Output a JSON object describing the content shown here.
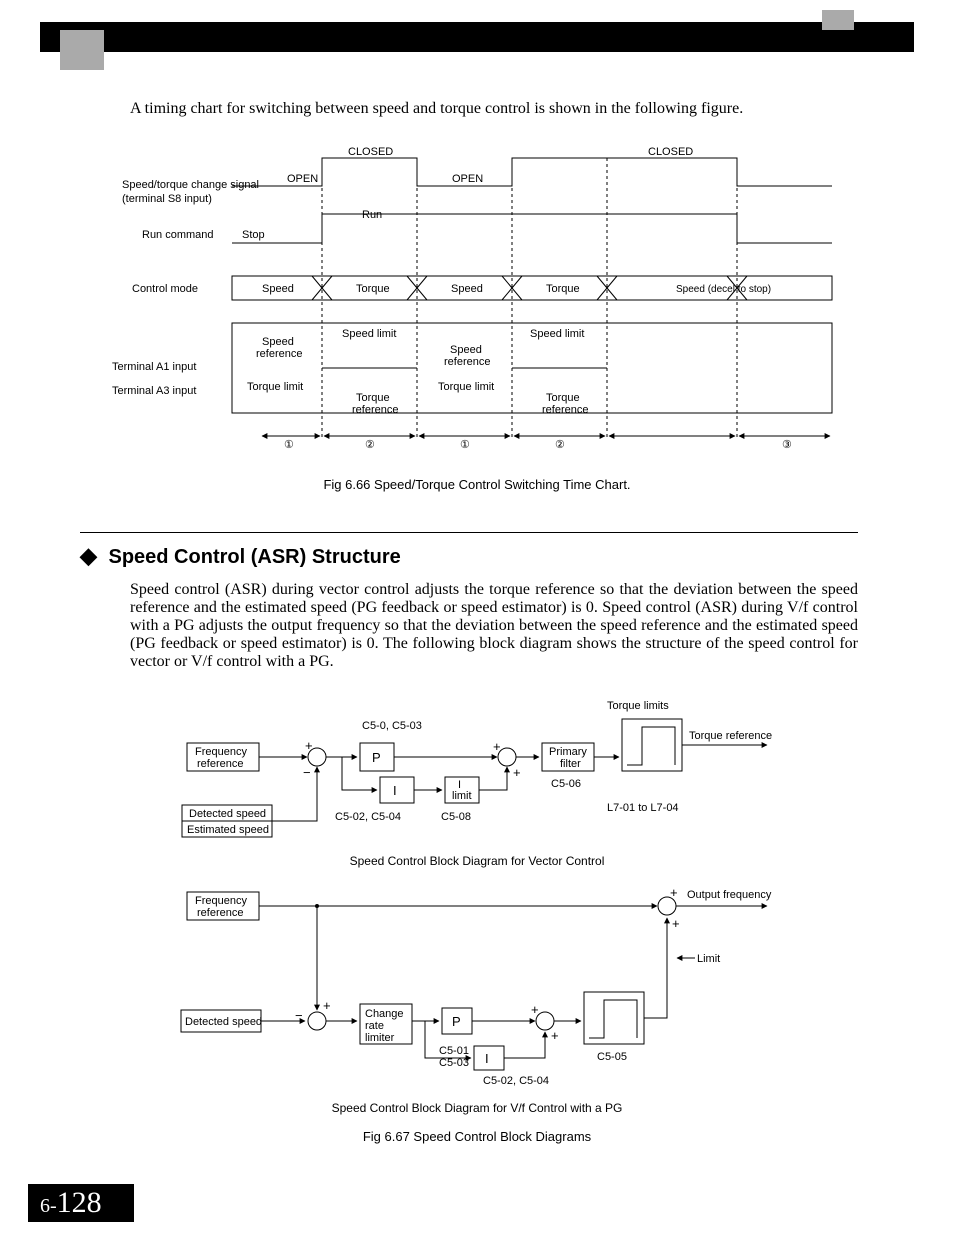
{
  "intro": "A timing chart for switching between speed and torque control is shown in the following figure.",
  "timing": {
    "lbl_change_signal": "Speed/torque change signal",
    "lbl_change_sub": "(terminal S8 input)",
    "lbl_run": "Run command",
    "lbl_mode": "Control mode",
    "lbl_a1": "Terminal A1 input",
    "lbl_a3": "Terminal A3 input",
    "open": "OPEN",
    "closed": "CLOSED",
    "run": "Run",
    "stop": "Stop",
    "torque": "Torque",
    "speed": "Speed",
    "speed_decel": "Speed (decel to stop)",
    "speed_limit": "Speed limit",
    "speed_ref": "Speed",
    "speed_ref_sub": "reference",
    "torque_ref": "Torque",
    "torque_ref_sub": "reference",
    "torque_limit": "Torque limit",
    "mark1": "①",
    "mark2": "②",
    "mark3": "③",
    "caption": "Fig 6.66  Speed/Torque Control Switching Time Chart."
  },
  "section": {
    "title": "Speed Control (ASR) Structure",
    "body": "Speed control (ASR) during vector control adjusts the torque reference so that the deviation between the speed reference and the estimated speed (PG feedback or speed estimator) is 0. Speed control (ASR) during V/f control with a PG adjusts the output frequency so that the deviation between the speed reference and the estimated speed (PG feedback or speed estimator) is 0. The following block diagram shows the structure of the speed control for vector or V/f control with a PG."
  },
  "diag1": {
    "freq_ref": "Frequency",
    "freq_ref_sub": "reference",
    "detected": "Detected speed",
    "estimated": "Estimated speed",
    "P": "P",
    "I": "I",
    "i_limit": "I",
    "i_limit_sub": "limit",
    "primary": "Primary",
    "primary_sub": "filter",
    "torque_limits": "Torque limits",
    "torque_ref": "Torque reference",
    "c50_c503": "C5-0, C5-03",
    "c502_c504": "C5-02, C5-04",
    "c508": "C5-08",
    "c506": "C5-06",
    "l7": "L7-01 to L7-04",
    "sub_caption": "Speed Control Block Diagram for Vector Control"
  },
  "diag2": {
    "freq_ref": "Frequency",
    "freq_ref_sub": "reference",
    "detected": "Detected speed",
    "change": "Change",
    "change_sub1": "rate",
    "change_sub2": "limiter",
    "P": "P",
    "I": "I",
    "limit": "Limit",
    "output": "Output frequency",
    "c501": "C5-01",
    "c503": "C5-03",
    "c502_c504": "C5-02, C5-04",
    "c505": "C5-05",
    "sub_caption": "Speed Control Block Diagram for V/f Control with a PG",
    "caption": "Fig 6.67  Speed Control Block Diagrams"
  },
  "page": {
    "chap": "6-",
    "num": "128"
  }
}
